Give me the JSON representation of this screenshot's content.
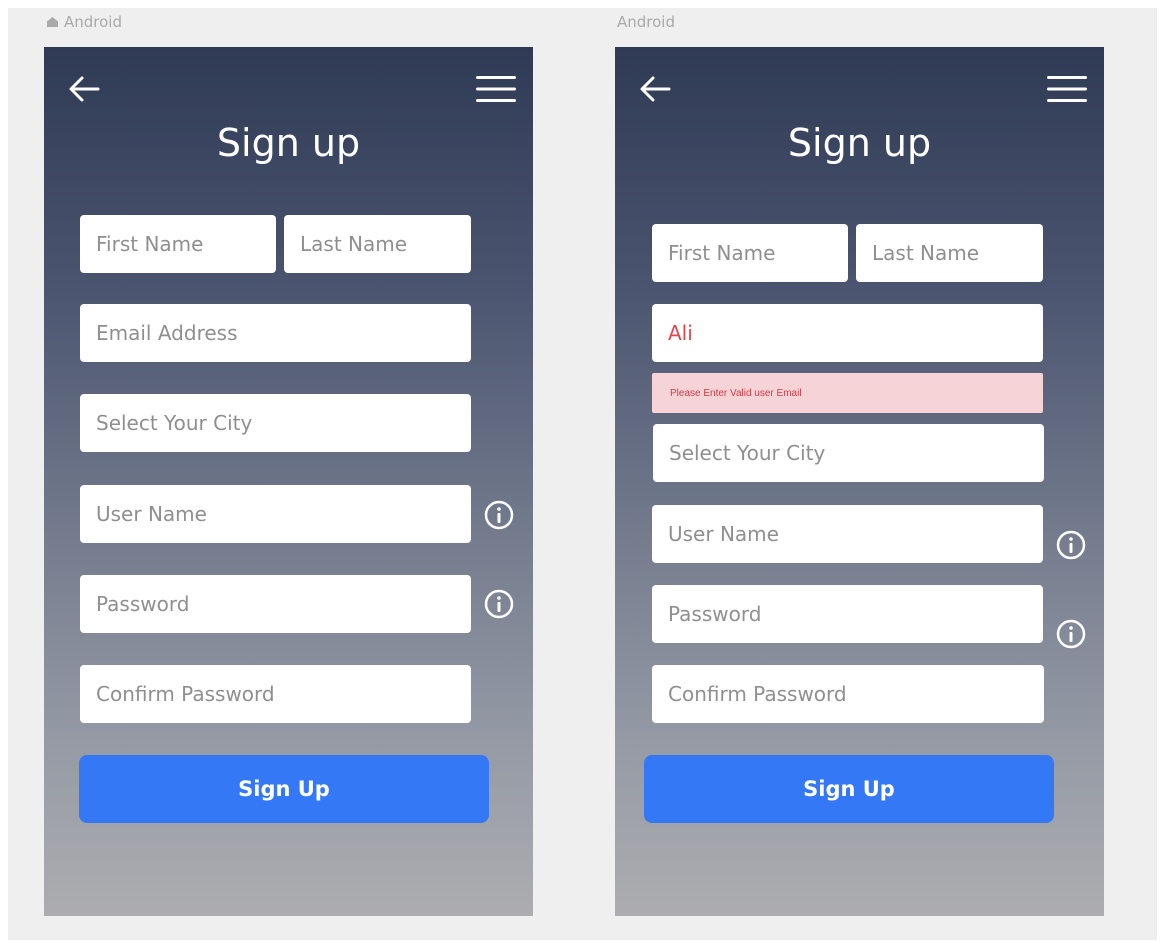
{
  "screens": [
    {
      "frame_label": "Android",
      "title": "Sign up",
      "first_name_placeholder": "First Name",
      "last_name_placeholder": "Last Name",
      "email_placeholder": "Email Address",
      "city_placeholder": "Select Your City",
      "username_placeholder": "User Name",
      "password_placeholder": "Password",
      "confirm_password_placeholder": "Confirm Password",
      "submit_label": "Sign Up"
    },
    {
      "frame_label": "Android",
      "title": "Sign up",
      "first_name_placeholder": "First Name",
      "last_name_placeholder": "Last Name",
      "email_value": "Ali",
      "email_error": "Please Enter Valid user Email",
      "city_placeholder": "Select Your City",
      "username_placeholder": "User Name",
      "password_placeholder": "Password",
      "confirm_password_placeholder": "Confirm Password",
      "submit_label": "Sign Up"
    }
  ],
  "icons": {
    "back": "arrow-left-icon",
    "menu": "hamburger-menu-icon",
    "info": "info-circle-icon",
    "frame": "home-icon"
  },
  "colors": {
    "gradient_top": "#2f3a55",
    "gradient_bottom": "#adadb0",
    "submit": "#3478f6",
    "error_background": "#f5d3d7",
    "error_text": "#d23b45",
    "invalid_value": "#e0474c"
  }
}
